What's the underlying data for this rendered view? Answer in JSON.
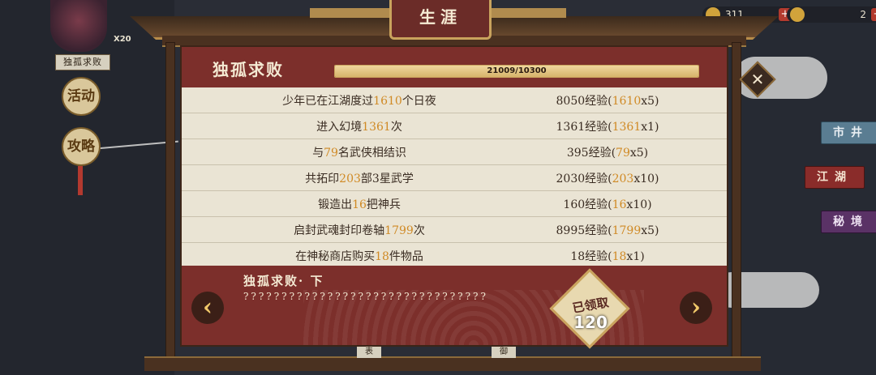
{
  "screen_title": "生涯",
  "left_hud": {
    "player_name": "独孤求败",
    "x_count": "X20",
    "activity_icon_text": "活动",
    "guide_icon_text": "攻略"
  },
  "resources": [
    {
      "value": "311"
    },
    {
      "value": "2"
    }
  ],
  "side_tabs": [
    {
      "label": "市井"
    },
    {
      "label": "江湖"
    },
    {
      "label": "秘境"
    }
  ],
  "panel": {
    "title": "独孤求败",
    "progress_text": "21009/10300",
    "progress_fraction": 1.0,
    "rows": [
      {
        "pre": "少年已在江湖度过",
        "num": "1610",
        "post": "个日夜",
        "exp_base": "8050经验(",
        "exp_num": "1610",
        "exp_mult": "x5)"
      },
      {
        "pre": "进入幻境",
        "num": "1361",
        "post": "次",
        "exp_base": "1361经验(",
        "exp_num": "1361",
        "exp_mult": "x1)"
      },
      {
        "pre": "与",
        "num": "79",
        "post": "名武侠相结识",
        "exp_base": "395经验(",
        "exp_num": "79",
        "exp_mult": "x5)"
      },
      {
        "pre": "共拓印",
        "num": "203",
        "post": "部3星武学",
        "exp_base": "2030经验(",
        "exp_num": "203",
        "exp_mult": "x10)"
      },
      {
        "pre": "锻造出",
        "num": "16",
        "post": "把神兵",
        "exp_base": "160经验(",
        "exp_num": "16",
        "exp_mult": "x10)"
      },
      {
        "pre": "启封武魂封印卷轴",
        "num": "1799",
        "post": "次",
        "exp_base": "8995经验(",
        "exp_num": "1799",
        "exp_mult": "x5)"
      },
      {
        "pre": "在神秘商店购买",
        "num": "18",
        "post": "件物品",
        "exp_base": "18经验(",
        "exp_num": "18",
        "exp_mult": "x1)"
      }
    ],
    "footer": {
      "title": "独孤求败· 下",
      "description": "????????????????????????????????",
      "reward_stamp": "已领取",
      "reward_count": "120"
    }
  },
  "bottom_labels": [
    "表",
    "御"
  ]
}
